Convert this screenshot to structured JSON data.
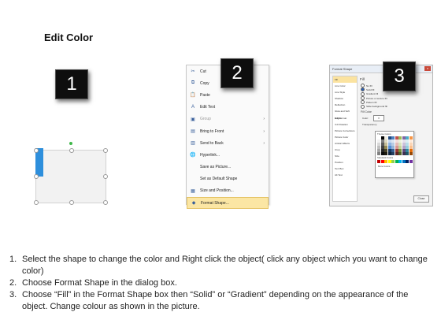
{
  "title": "Edit Color",
  "badges": [
    "1",
    "2",
    "3"
  ],
  "context_menu": {
    "items": [
      {
        "label": "Cut",
        "icon": "scissors-icon",
        "glyph": "✂",
        "disabled": false,
        "submenu": false,
        "highlight": false
      },
      {
        "label": "Copy",
        "icon": "copy-icon",
        "glyph": "⧉",
        "disabled": false,
        "submenu": false,
        "highlight": false
      },
      {
        "label": "Paste",
        "icon": "paste-icon",
        "glyph": "📋",
        "disabled": false,
        "submenu": false,
        "highlight": false
      },
      {
        "label": "Edit Text",
        "icon": "edit-text-icon",
        "glyph": "A",
        "disabled": false,
        "submenu": false,
        "highlight": false
      },
      {
        "label": "Group",
        "icon": "group-icon",
        "glyph": "▣",
        "disabled": true,
        "submenu": true,
        "highlight": false
      },
      {
        "label": "Bring to Front",
        "icon": "bring-to-front-icon",
        "glyph": "▤",
        "disabled": false,
        "submenu": true,
        "highlight": false
      },
      {
        "label": "Send to Back",
        "icon": "send-to-back-icon",
        "glyph": "▥",
        "disabled": false,
        "submenu": true,
        "highlight": false
      },
      {
        "label": "Hyperlink...",
        "icon": "hyperlink-icon",
        "glyph": "🌐",
        "disabled": false,
        "submenu": false,
        "highlight": false
      },
      {
        "label": "Save as Picture...",
        "icon": "",
        "glyph": "",
        "disabled": false,
        "submenu": false,
        "highlight": false
      },
      {
        "label": "Set as Default Shape",
        "icon": "",
        "glyph": "",
        "disabled": false,
        "submenu": false,
        "highlight": false
      },
      {
        "label": "Size and Position...",
        "icon": "size-position-icon",
        "glyph": "▦",
        "disabled": false,
        "submenu": false,
        "highlight": false
      },
      {
        "label": "Format Shape...",
        "icon": "format-shape-icon",
        "glyph": "◆",
        "disabled": false,
        "submenu": false,
        "highlight": true
      }
    ]
  },
  "format_dialog": {
    "title": "Format Shape",
    "close_glyph": "x",
    "categories": [
      "Fill",
      "Line Color",
      "Line Style",
      "Shadow",
      "Reflection",
      "Glow and Soft Edges",
      "3-D Format",
      "3-D Rotation",
      "Picture Corrections",
      "Picture Color",
      "Artistic Effects",
      "Crop",
      "Size",
      "Position",
      "Text Box",
      "Alt Text"
    ],
    "section": "Fill",
    "options": [
      {
        "label": "No fill",
        "on": false
      },
      {
        "label": "Solid fill",
        "on": true
      },
      {
        "label": "Gradient fill",
        "on": false
      },
      {
        "label": "Picture or texture fill",
        "on": false
      },
      {
        "label": "Pattern fill",
        "on": false
      },
      {
        "label": "Slide background fill",
        "on": false
      }
    ],
    "sub_section": "Fill Color",
    "color_label": "Color:",
    "transparency_label": "Transparency:",
    "close_label": "Close",
    "palette": {
      "theme_label": "Theme Colors",
      "standard_label": "Standard Colors",
      "more_label": "More Colors...",
      "theme_colors": [
        "#ffffff",
        "#000000",
        "#eeece1",
        "#1f497d",
        "#4f81bd",
        "#c0504d",
        "#9bbb59",
        "#8064a2",
        "#4bacc6",
        "#f79646",
        "#f2f2f2",
        "#7f7f7f",
        "#ddd9c3",
        "#c6d9f0",
        "#dbe5f1",
        "#f2dcdb",
        "#ebf1dd",
        "#e5e0ec",
        "#dbeef3",
        "#fdeada",
        "#d8d8d8",
        "#595959",
        "#c4bd97",
        "#8db3e2",
        "#b8cce4",
        "#e5b9b7",
        "#d7e3bc",
        "#ccc1d9",
        "#b7dde8",
        "#fbd5b5",
        "#bfbfbf",
        "#3f3f3f",
        "#938953",
        "#548dd4",
        "#95b3d7",
        "#d99694",
        "#c3d69b",
        "#b2a2c7",
        "#92cddc",
        "#fac08f",
        "#a5a5a5",
        "#262626",
        "#494429",
        "#17365d",
        "#366092",
        "#953734",
        "#76923c",
        "#5f497a",
        "#31859b",
        "#e36c09",
        "#7f7f7f",
        "#0c0c0c",
        "#1d1b10",
        "#0f243e",
        "#244061",
        "#632423",
        "#4f6128",
        "#3f3151",
        "#205867",
        "#974806"
      ],
      "standard_colors": [
        "#c00000",
        "#ff0000",
        "#ffc000",
        "#ffff00",
        "#92d050",
        "#00b050",
        "#00b0f0",
        "#0070c0",
        "#002060",
        "#7030a0"
      ]
    }
  },
  "steps": [
    {
      "num": "1.",
      "text": "Select the shape to change the color and Right click the object( click any object which you want to change color)"
    },
    {
      "num": "2.",
      "text": "Choose Format Shape in the dialog box."
    },
    {
      "num": "3.",
      "text": "Choose “Fill” in the Format Shape box then “Solid” or “Gradient” depending on the appearance of the object. Change colour as shown in the picture."
    }
  ]
}
